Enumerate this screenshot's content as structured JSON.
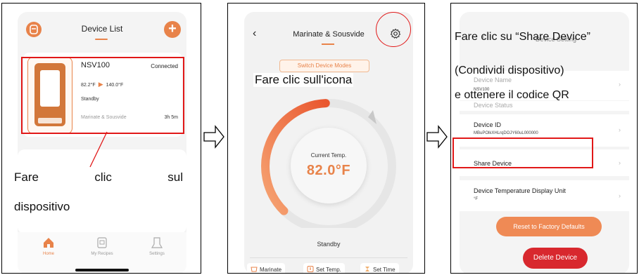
{
  "panel1": {
    "header_title": "Device List",
    "device": {
      "name": "NSV100",
      "status": "Connected",
      "current_temp": "82.2°F",
      "target_temp": "140.0°F",
      "state": "Standby",
      "mode": "Marinate & Sousvide",
      "time": "3h 5m"
    },
    "caption_words": [
      "Fare",
      "clic",
      "sul"
    ],
    "caption_line2": "dispositivo",
    "tabs": [
      {
        "label": "Home",
        "icon": "home-icon",
        "active": true
      },
      {
        "label": "My Recipes",
        "icon": "recipes-icon",
        "active": false
      },
      {
        "label": "Settings",
        "icon": "settings-icon",
        "active": false
      }
    ]
  },
  "panel2": {
    "back_glyph": "‹",
    "header_title": "Marinate & Sousvide",
    "switch_modes_label": "Switch Device Modes",
    "current_temp_label": "Current Temp.",
    "current_temp_value": "82.0°F",
    "state": "Standby",
    "caption": "Fare clic sull'icona",
    "actions": [
      {
        "label": "Marinate",
        "icon": "marinate-icon"
      },
      {
        "label": "Set Temp.",
        "icon": "thermometer-icon"
      },
      {
        "label": "Set Time",
        "icon": "timer-icon"
      }
    ],
    "gauge_fraction": 0.4
  },
  "panel3": {
    "ghost_title": "Device Setting",
    "rows": {
      "name": {
        "label": "Device Name",
        "value": "NSV100"
      },
      "status": {
        "label": "Device Status"
      },
      "id": {
        "label": "Device ID",
        "value": "MBuPOlkXHLrqDOJY60uL000000"
      },
      "share": {
        "label": "Share Device"
      },
      "unit": {
        "label": "Device Temperature Display Unit",
        "value": "°F"
      }
    },
    "reset_label": "Reset to Factory Defaults",
    "delete_label": "Delete Device",
    "caption_line1": "Fare clic su “Share Device”",
    "caption_line2": "(Condividi dispositivo)",
    "caption_line3": "e ottenere il codice QR"
  },
  "colors": {
    "accent": "#e8834a",
    "annotation_red": "#e11818",
    "delete_red": "#d8282e"
  }
}
